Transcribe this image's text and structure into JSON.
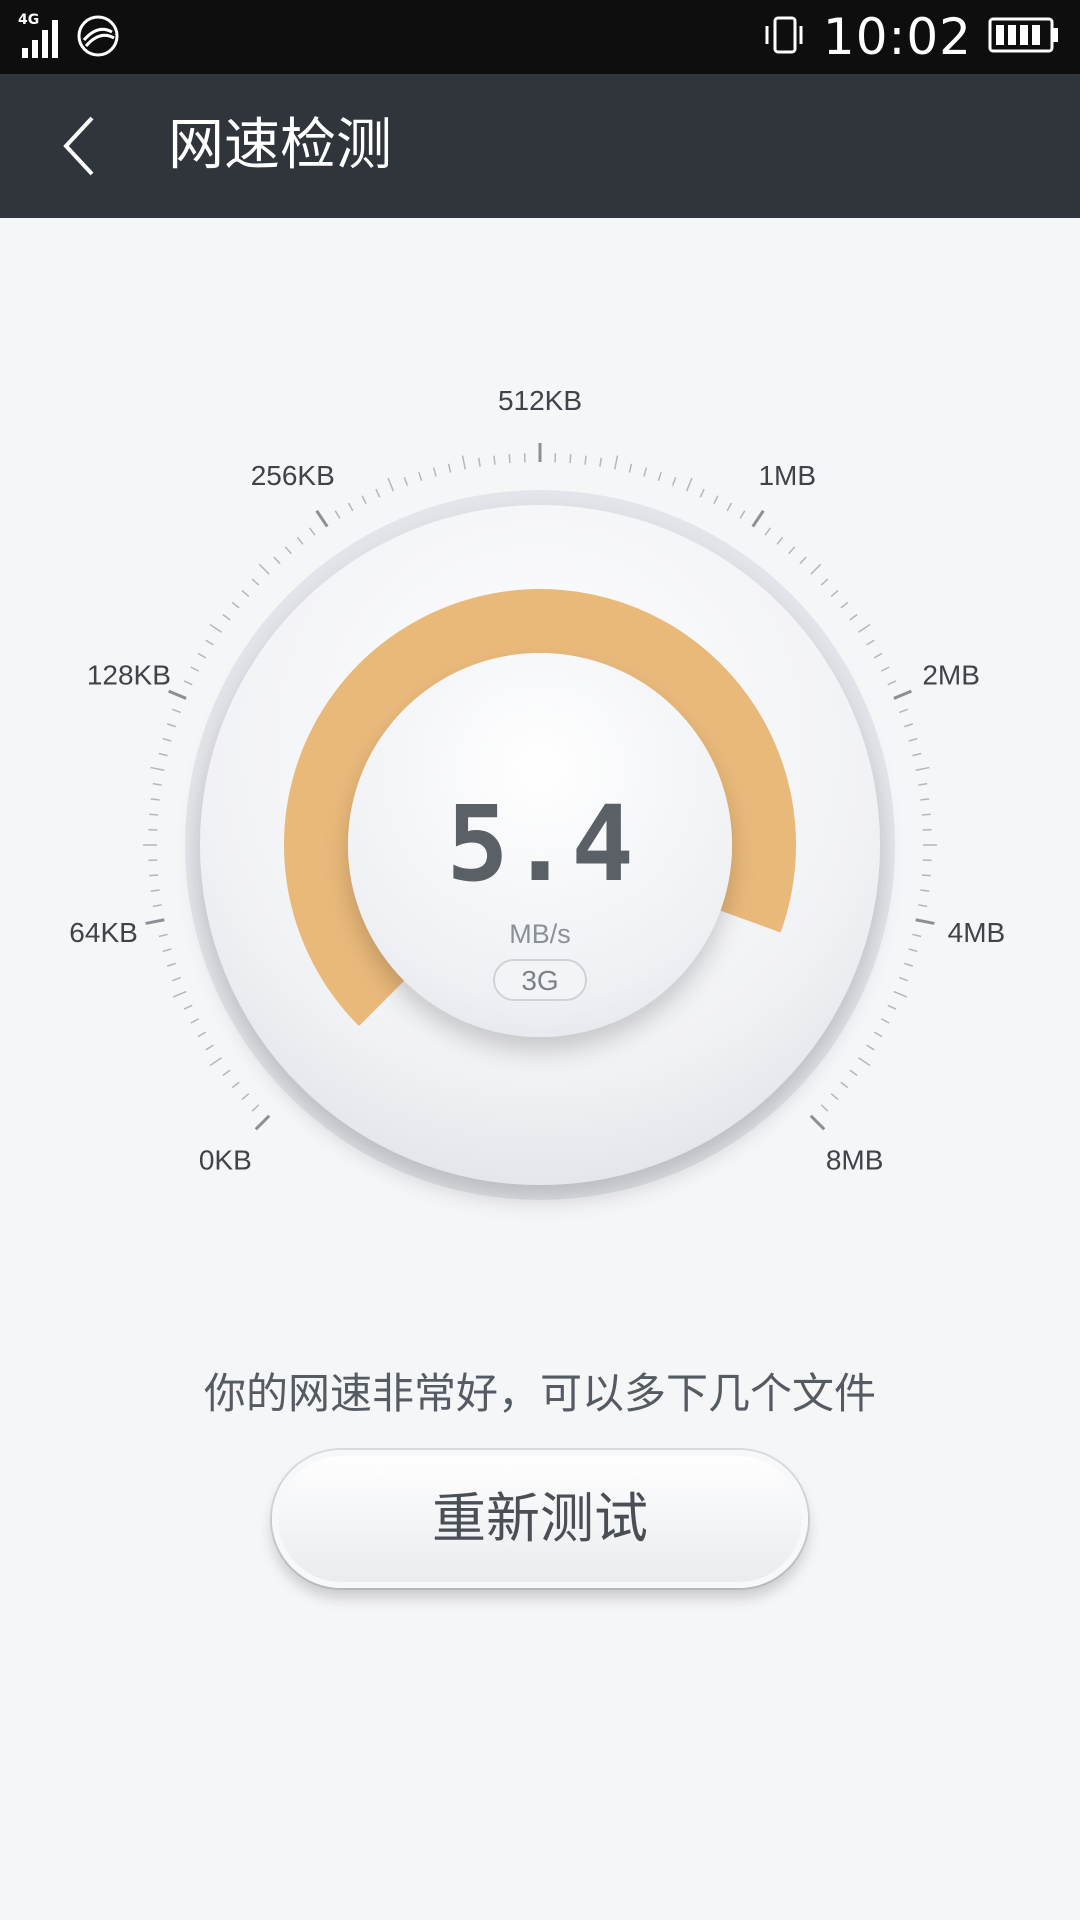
{
  "status_bar": {
    "network_type": "4G",
    "time": "10:02",
    "icons": [
      "signal-icon",
      "carrier-icon",
      "vibrate-icon",
      "battery-icon"
    ]
  },
  "app_bar": {
    "title": "网速检测"
  },
  "gauge": {
    "speed_value": "5.4",
    "speed_unit": "MB/s",
    "connection_type": "3G",
    "scale_labels": [
      "0KB",
      "64KB",
      "128KB",
      "256KB",
      "512KB",
      "1MB",
      "2MB",
      "4MB",
      "8MB"
    ],
    "progress_color": "#e9b97a"
  },
  "message": "你的网速非常好，可以多下几个文件",
  "retest_button_label": "重新测试"
}
